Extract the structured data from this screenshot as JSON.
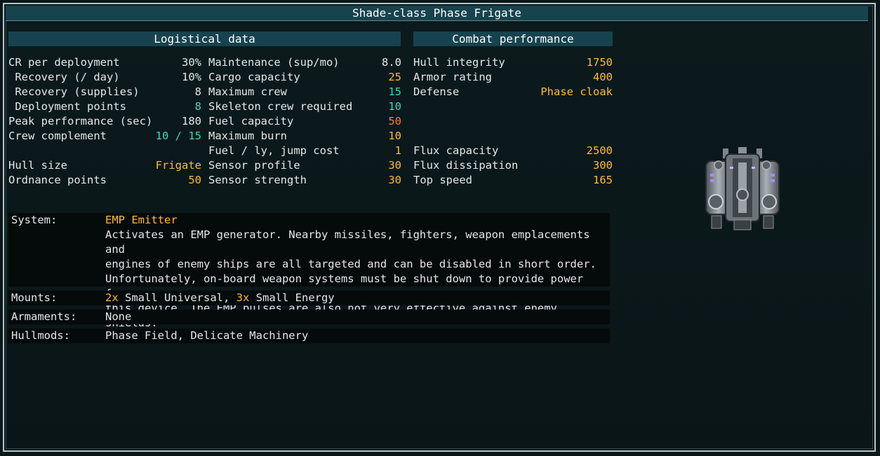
{
  "title": "Shade-class Phase Frigate",
  "logistical": {
    "header": "Logistical data",
    "col1": [
      {
        "label": "CR per deployment",
        "value": "30%",
        "color": "white"
      },
      {
        "label": " Recovery (/ day)",
        "value": "10%",
        "color": "white"
      },
      {
        "label": " Recovery (supplies)",
        "value": "8",
        "color": "white"
      },
      {
        "label": " Deployment points",
        "value": "8",
        "color": "teal"
      },
      {
        "label": "Peak performance (sec)",
        "value": "180",
        "color": "white"
      },
      {
        "label": "Crew complement",
        "value": "10 / 15",
        "color": "teal"
      },
      {
        "label": "Hull size",
        "value": "Frigate",
        "color": "orange"
      },
      {
        "label": "Ordnance points",
        "value": "50",
        "color": "orange"
      }
    ],
    "col2": [
      {
        "label": "Maintenance (sup/mo)",
        "value": "8.0",
        "color": "white"
      },
      {
        "label": "Cargo capacity",
        "value": "25",
        "color": "orange"
      },
      {
        "label": "Maximum crew",
        "value": "15",
        "color": "teal"
      },
      {
        "label": "Skeleton crew required",
        "value": "10",
        "color": "teal"
      },
      {
        "label": "Fuel capacity",
        "value": "50",
        "color": "red"
      },
      {
        "label": "Maximum burn",
        "value": "10",
        "color": "orange"
      },
      {
        "label": "Fuel / ly, jump cost",
        "value": "1",
        "color": "orange"
      },
      {
        "label": "Sensor profile",
        "value": "30",
        "color": "orange"
      },
      {
        "label": "Sensor strength",
        "value": "30",
        "color": "orange"
      }
    ]
  },
  "combat": {
    "header": "Combat performance",
    "rows": [
      {
        "label": "Hull integrity",
        "value": "1750",
        "color": "orange"
      },
      {
        "label": "Armor rating",
        "value": "400",
        "color": "orange"
      },
      {
        "label": "Defense",
        "value": "Phase cloak",
        "color": "orange"
      },
      {
        "label": "Flux capacity",
        "value": "2500",
        "color": "orange"
      },
      {
        "label": "Flux dissipation",
        "value": "300",
        "color": "orange"
      },
      {
        "label": "Top speed",
        "value": "165",
        "color": "orange"
      }
    ]
  },
  "details": {
    "system_label": "System:",
    "system_name": "EMP Emitter",
    "system_desc": [
      "Activates an EMP generator. Nearby missiles, fighters, weapon emplacements and",
      "engines of enemy ships are all targeted and can be disabled in short order.",
      "Unfortunately, on-board weapon systems must be shut down to provide power for",
      "this device. The EMP pulses are also not very effective against enemy shields."
    ],
    "mounts_label": "Mounts:",
    "mounts_count_1": "2x",
    "mounts_text_1": " Small Universal, ",
    "mounts_count_2": "3x",
    "mounts_text_2": " Small Energy",
    "armaments_label": "Armaments:",
    "armaments_value": "None",
    "hullmods_label": "Hullmods:",
    "hullmods_value": "Phase Field, Delicate Machinery"
  }
}
